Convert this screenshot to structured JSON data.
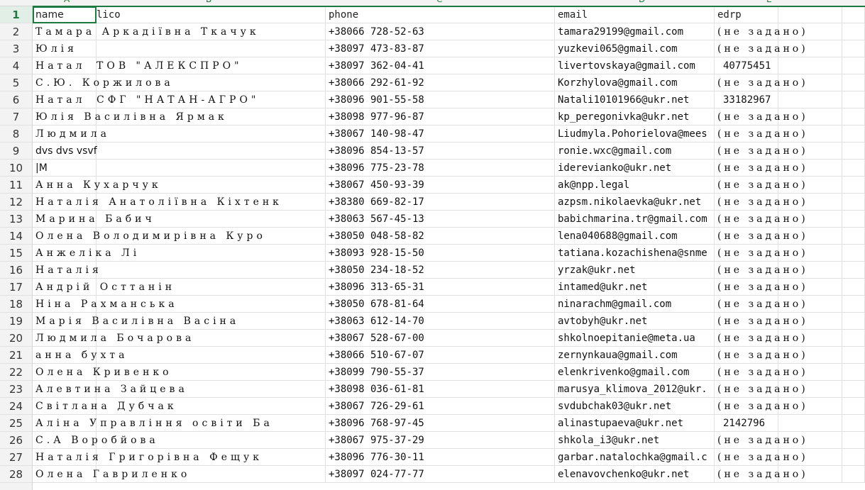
{
  "column_letters": [
    "A",
    "B",
    "C",
    "D",
    "E"
  ],
  "rows": [
    {
      "n": "1",
      "name": "name",
      "lico": "lico",
      "phone": "phone",
      "email": "email",
      "edrp": "edrp",
      "header": true
    },
    {
      "n": "2",
      "name": "Тамара Аркадіївна Ткачук",
      "lico": "",
      "phone": "+38066 728-52-63",
      "email": "tamara29199@gmail.com",
      "edrp": "(не задано)"
    },
    {
      "n": "3",
      "name": "Юлія",
      "lico": "",
      "phone": "+38097 473-83-87",
      "email": "yuzkevi065@gmail.com",
      "edrp": "(не задано)"
    },
    {
      "n": "4",
      "name": "Натал",
      "lico": "ТОВ \"АЛЕКСПРО\"",
      "phone": "+38097 362-04-41",
      "email": "livertovskaya@gmail.com",
      "edrp": "40775451"
    },
    {
      "n": "5",
      "name": "С.Ю. Коржилова",
      "lico": "",
      "phone": "+38066 292-61-92",
      "email": "Korzhylova@gmail.com",
      "edrp": "(не задано)"
    },
    {
      "n": "6",
      "name": "Натал",
      "lico": "СФГ \"НАТАН-АГРО\"",
      "phone": "+38096 901-55-58",
      "email": "Natali10101966@ukr.net",
      "edrp": "33182967"
    },
    {
      "n": "7",
      "name": "Юлія Василівна Ярмак",
      "lico": "",
      "phone": "+38098 977-96-87",
      "email": "kp_peregonivka@ukr.net",
      "edrp": "(не задано)"
    },
    {
      "n": "8",
      "name": "Людмила",
      "lico": "",
      "phone": "+38067 140-98-47",
      "email": "Liudmyla.Pohorielova@mees",
      "edrp": "(не задано)"
    },
    {
      "n": "9",
      "name": "dvs dvs vsvf",
      "lico": "",
      "phone": "+38096 854-13-57",
      "email": "ronie.wxc@gmail.com",
      "edrp": "(не задано)"
    },
    {
      "n": "10",
      "name": "|M",
      "lico": "",
      "phone": "+38096 775-23-78",
      "email": "iderevianko@ukr.net",
      "edrp": "(не задано)"
    },
    {
      "n": "11",
      "name": "Анна Кухарчук",
      "lico": "",
      "phone": "+38067 450-93-39",
      "email": "ak@npp.legal",
      "edrp": "(не задано)"
    },
    {
      "n": "12",
      "name": "Наталія Анатоліївна Кіхтенк",
      "lico": "",
      "phone": "+38380 669-82-17",
      "email": "azpsm.nikolaevka@ukr.net",
      "edrp": "(не задано)"
    },
    {
      "n": "13",
      "name": "Марина Бабич",
      "lico": "",
      "phone": "+38063 567-45-13",
      "email": "babichmarina.tr@gmail.com",
      "edrp": "(не задано)"
    },
    {
      "n": "14",
      "name": "Олена Володимирівна Куро",
      "lico": "",
      "phone": "+38050 048-58-82",
      "email": "lena040688@gmail.com",
      "edrp": "(не задано)"
    },
    {
      "n": "15",
      "name": "Анжеліка Лі",
      "lico": "",
      "phone": "+38093 928-15-50",
      "email": "tatiana.kozachishena@snme",
      "edrp": "(не задано)"
    },
    {
      "n": "16",
      "name": "Наталія",
      "lico": "",
      "phone": "+38050 234-18-52",
      "email": "yrzak@ukr.net",
      "edrp": "(не задано)"
    },
    {
      "n": "17",
      "name": "Андрій Осттанін",
      "lico": "",
      "phone": "+38096 313-65-31",
      "email": "intamed@ukr.net",
      "edrp": "(не задано)"
    },
    {
      "n": "18",
      "name": "Ніна Рахманська",
      "lico": "",
      "phone": "+38050 678-81-64",
      "email": "ninarachm@gmail.com",
      "edrp": "(не задано)"
    },
    {
      "n": "19",
      "name": "Марія Василівна Васіна",
      "lico": "",
      "phone": "+38063 612-14-70",
      "email": "avtobyh@ukr.net",
      "edrp": "(не задано)"
    },
    {
      "n": "20",
      "name": "Людмила Бочарова",
      "lico": "",
      "phone": "+38067 528-67-00",
      "email": "shkolnoepitanie@meta.ua",
      "edrp": "(не задано)"
    },
    {
      "n": "21",
      "name": "анна бухта",
      "lico": "",
      "phone": "+38066 510-67-07",
      "email": "zernynkaua@gmail.com",
      "edrp": "(не задано)"
    },
    {
      "n": "22",
      "name": "Олена Кривенко",
      "lico": "",
      "phone": "+38099 790-55-37",
      "email": "elenkrivenko@gmail.com",
      "edrp": "(не задано)"
    },
    {
      "n": "23",
      "name": "Алевтина Зайцева",
      "lico": "",
      "phone": "+38098 036-61-81",
      "email": "marusya_klimova_2012@ukr.",
      "edrp": "(не задано)"
    },
    {
      "n": "24",
      "name": "Світлана Дубчак",
      "lico": "",
      "phone": "+38067 726-29-61",
      "email": "svdubchak03@ukr.net",
      "edrp": "(не задано)"
    },
    {
      "n": "25",
      "name": "Аліна Управління освіти Ба",
      "lico": "",
      "phone": "+38096 768-97-45",
      "email": "alinastupaeva@ukr.net",
      "edrp": "2142796"
    },
    {
      "n": "26",
      "name": "С.А Воробйова",
      "lico": "",
      "phone": "+38067 975-37-29",
      "email": "shkola_i3@ukr.net",
      "edrp": "(не задано)"
    },
    {
      "n": "27",
      "name": "Наталія Григорівна Фещук",
      "lico": "",
      "phone": "+38096 776-30-11",
      "email": "garbar.natalochka@gmail.c",
      "edrp": "(не задано)"
    },
    {
      "n": "28",
      "name": "Олена Гавриленко",
      "lico": "",
      "phone": "+38097 024-77-77",
      "email": "elenavovchenko@ukr.net",
      "edrp": "(не задано)"
    }
  ],
  "colors": {
    "accent": "#1e7a3e",
    "gridline": "#e1e1e1",
    "header_bg": "#f3f3f3"
  }
}
